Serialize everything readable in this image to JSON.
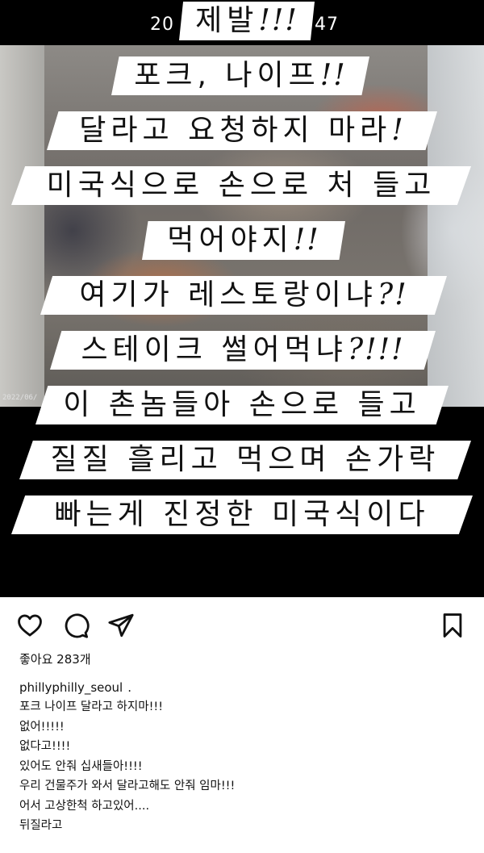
{
  "post": {
    "media": {
      "timestamp_left": "20",
      "timestamp_right": "47",
      "date_stamp": "2022/06/",
      "captions": [
        "제발!!!",
        "포크, 나이프!!",
        "달라고 요청하지 마라!",
        "미국식으로 손으로 처 들고",
        "먹어야지!!",
        "여기가 레스토랑이냐?!",
        "스테이크 썰어먹냐?!!!",
        "이 촌놈들아 손으로 들고",
        "질질 흘리고 먹으며 손가락",
        "빠는게 진정한 미국식이다"
      ]
    },
    "actions": {
      "like_icon": "heart-icon",
      "comment_icon": "comment-icon",
      "share_icon": "paper-plane-icon",
      "save_icon": "bookmark-icon"
    },
    "likes_text": "좋아요 283개",
    "author": {
      "username": "phillyphilly_seoul",
      "separator": "."
    },
    "caption_lines": [
      "포크 나이프 달라고 하지마!!!",
      "없어!!!!!",
      "없다고!!!!",
      "있어도 안줘 십새들아!!!!",
      "우리 건물주가 와서 달라고해도 안줘 임마!!!",
      "어서 고상한척 하고있어....",
      "뒤질라고"
    ]
  },
  "colors": {
    "media_background": "#000000",
    "caption_box": "#ffffff",
    "text": "#111111"
  }
}
